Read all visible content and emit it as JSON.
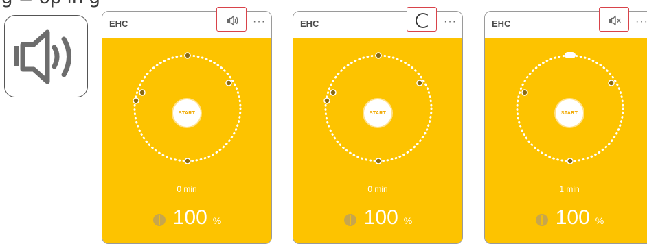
{
  "caption": "g = op in g",
  "big_icon": "speaker-on-icon",
  "panels": [
    {
      "title": "EHC",
      "more_label": "···",
      "sound_icon": "speaker-on-icon",
      "start_label": "START",
      "duration": "0 min",
      "battery_value": "100",
      "battery_unit": "%"
    },
    {
      "title": "EHC",
      "more_label": "···",
      "sound_icon": "loading-spinner-icon",
      "start_label": "START",
      "duration": "0 min",
      "battery_value": "100",
      "battery_unit": "%"
    },
    {
      "title": "EHC",
      "more_label": "···",
      "sound_icon": "speaker-muted-icon",
      "start_label": "START",
      "duration": "1 min",
      "battery_value": "100",
      "battery_unit": "%"
    }
  ],
  "colors": {
    "accent": "#fdc300",
    "highlight": "#d8434a",
    "marker": "#8a6a10"
  }
}
